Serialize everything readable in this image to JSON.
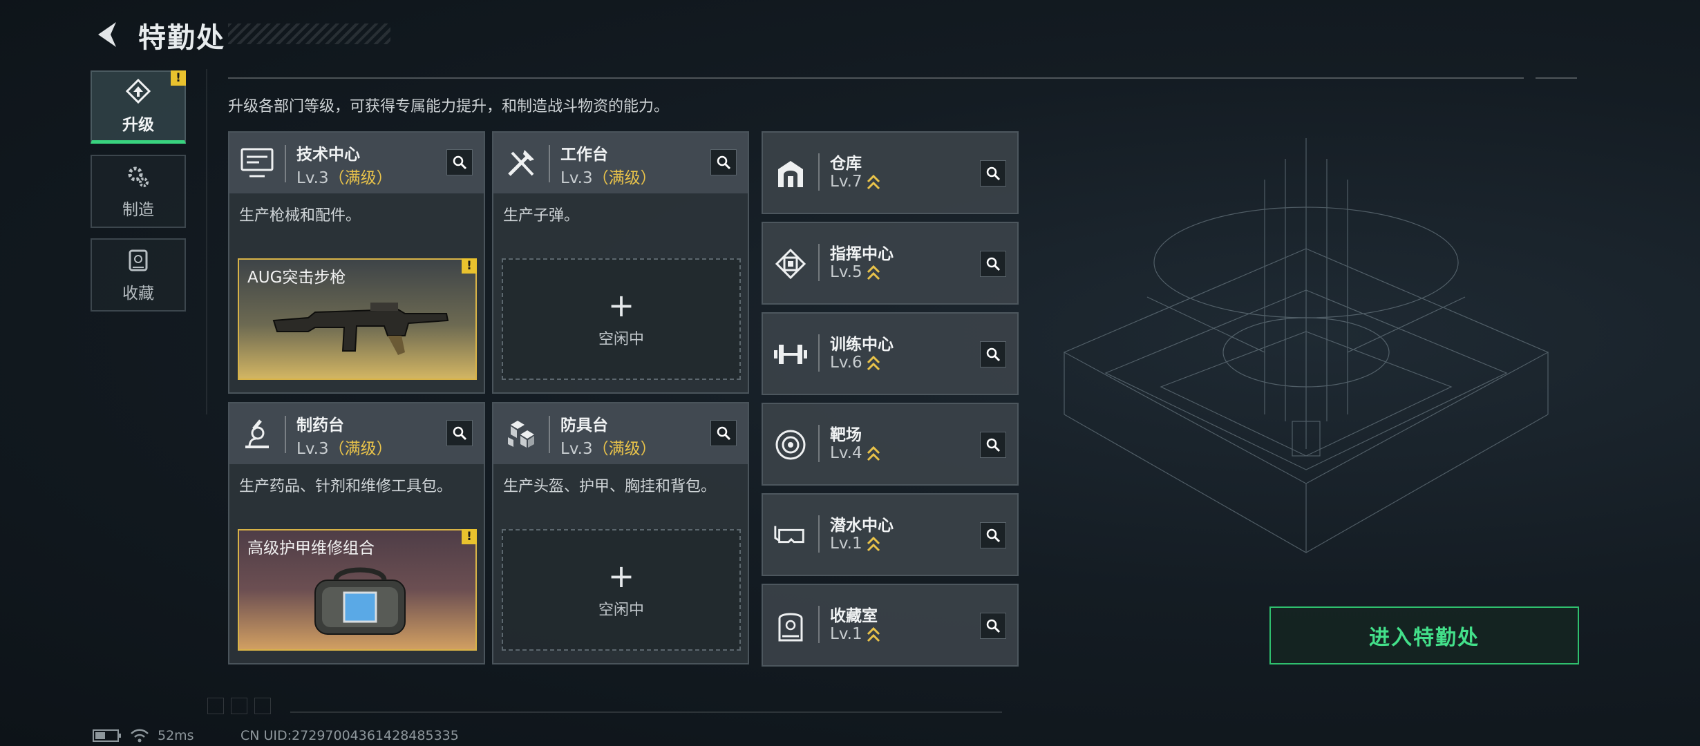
{
  "header": {
    "title": "特勤处"
  },
  "sidebar": {
    "tabs": [
      {
        "label": "升级",
        "active": true,
        "warn": "!"
      },
      {
        "label": "制造",
        "active": false
      },
      {
        "label": "收藏",
        "active": false
      }
    ]
  },
  "description": "升级各部门等级，可获得专属能力提升，和制造战斗物资的能力。",
  "cards": [
    {
      "name": "技术中心",
      "level": "Lv.3",
      "max_label": "（满级）",
      "desc": "生产枪械和配件。",
      "product": {
        "name": "AUG突击步枪",
        "warn": "!"
      },
      "icon": "monitor-icon"
    },
    {
      "name": "工作台",
      "level": "Lv.3",
      "max_label": "（满级）",
      "desc": "生产子弹。",
      "idle": {
        "plus": "+",
        "label": "空闲中"
      },
      "icon": "tools-icon"
    },
    {
      "name": "制药台",
      "level": "Lv.3",
      "max_label": "（满级）",
      "desc": "生产药品、针剂和维修工具包。",
      "product": {
        "name": "高级护甲维修组合",
        "warn": "!"
      },
      "icon": "microscope-icon"
    },
    {
      "name": "防具台",
      "level": "Lv.3",
      "max_label": "（满级）",
      "desc": "生产头盔、护甲、胸挂和背包。",
      "idle": {
        "plus": "+",
        "label": "空闲中"
      },
      "icon": "armor-icon"
    }
  ],
  "small_cards": [
    {
      "name": "仓库",
      "level": "Lv.7",
      "icon": "warehouse-icon"
    },
    {
      "name": "指挥中心",
      "level": "Lv.5",
      "icon": "chip-icon"
    },
    {
      "name": "训练中心",
      "level": "Lv.6",
      "icon": "dumbbell-icon"
    },
    {
      "name": "靶场",
      "level": "Lv.4",
      "icon": "target-icon"
    },
    {
      "name": "潜水中心",
      "level": "Lv.1",
      "icon": "goggles-icon"
    },
    {
      "name": "收藏室",
      "level": "Lv.1",
      "icon": "trophy-icon"
    }
  ],
  "enter_button": "进入特勤处",
  "footer": {
    "ping": "52ms",
    "uid": "CN UID:272970043614284853​35"
  },
  "colors": {
    "accent_green": "#39d37f",
    "max_level_gold": "#e9c34a",
    "warn_yellow": "#e9c22e"
  }
}
